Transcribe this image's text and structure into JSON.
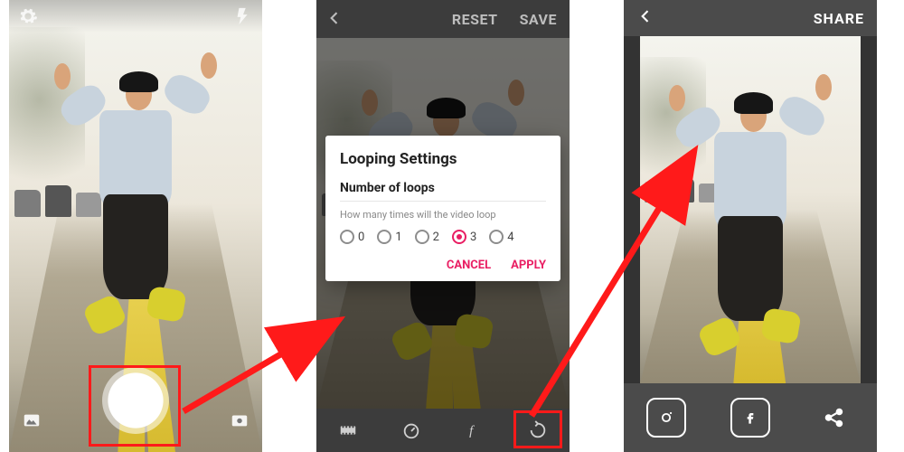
{
  "screen1": {
    "icons": {
      "settings": "gear-icon",
      "flash": "flash-icon",
      "gallery": "gallery-icon",
      "switch": "switch-camera-icon"
    }
  },
  "screen2": {
    "reset": "RESET",
    "save": "SAVE",
    "dialog": {
      "title": "Looping Settings",
      "subtitle": "Number of loops",
      "help": "How many times will the video loop",
      "options": [
        "0",
        "1",
        "2",
        "3",
        "4"
      ],
      "selected": "3",
      "cancel": "CANCEL",
      "apply": "APPLY"
    },
    "tools": {
      "clip": "film-icon",
      "speed": "speedometer-icon",
      "fx": "fx-icon",
      "loop": "loop-icon"
    }
  },
  "screen3": {
    "share": "SHARE",
    "targets": {
      "instagram": "instagram-icon",
      "facebook": "facebook-icon",
      "more": "share-icon"
    }
  }
}
